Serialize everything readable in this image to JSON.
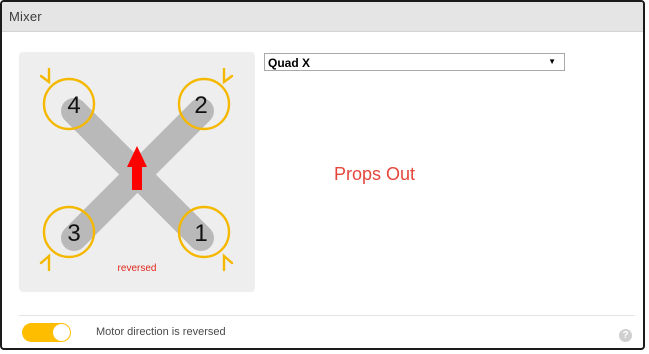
{
  "panel": {
    "title": "Mixer"
  },
  "mixer_select": {
    "value": "Quad X",
    "arrow_icon": "triangle-down-icon"
  },
  "diagram": {
    "motors": [
      "1",
      "2",
      "3",
      "4"
    ],
    "reversed_label": "reversed",
    "props_label": "Props Out",
    "colors": {
      "arm": "#b9b9b9",
      "prop": "#f5b800",
      "arrow": "#ff0000",
      "background": "#eeeeee"
    }
  },
  "motor_direction": {
    "label": "Motor direction is reversed",
    "enabled": true,
    "toggle_color": "#ffbd00"
  },
  "help": {
    "icon": "?"
  }
}
